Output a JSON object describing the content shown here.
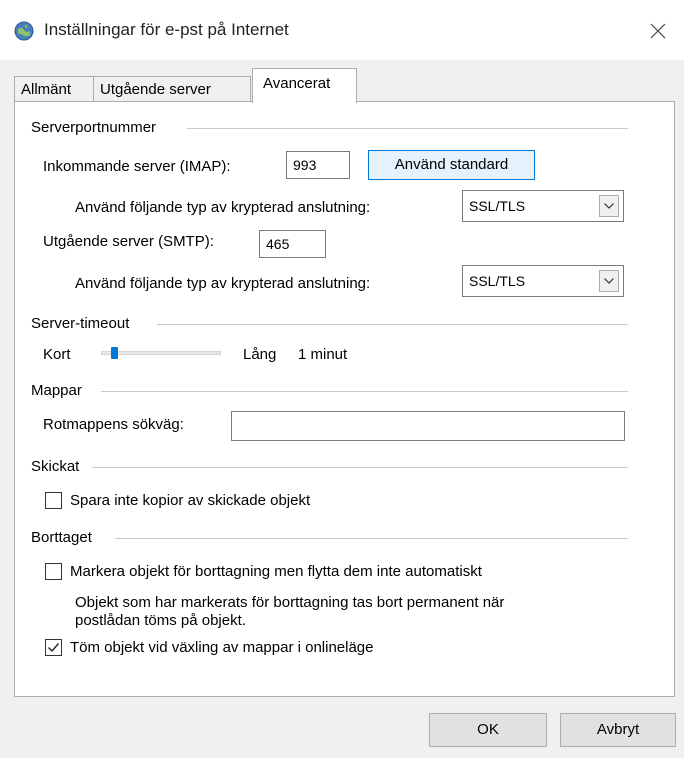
{
  "window": {
    "title": "Inställningar för e-pst på Internet"
  },
  "tabs": [
    {
      "label": "Allmänt"
    },
    {
      "label": "Utgående server"
    },
    {
      "label": "Avancerat"
    }
  ],
  "server_ports": {
    "group_label": "Serverportnummer",
    "incoming_label": "Inkommande server (IMAP):",
    "incoming_port": "993",
    "use_default_label": "Använd standard",
    "incoming_encryption_label": "Använd följande typ av krypterad anslutning:",
    "incoming_encryption_value": "SSL/TLS",
    "outgoing_label": "Utgående server (SMTP):",
    "outgoing_port": "465",
    "outgoing_encryption_label": "Använd följande typ av krypterad anslutning:",
    "outgoing_encryption_value": "SSL/TLS"
  },
  "server_timeout": {
    "group_label": "Server-timeout",
    "short_label": "Kort",
    "long_label": "Lång",
    "value_label": "1 minut",
    "slider_fraction": 0.1
  },
  "folders": {
    "group_label": "Mappar",
    "root_path_label": "Rotmappens sökväg:",
    "root_path_value": ""
  },
  "sent": {
    "group_label": "Skickat",
    "dont_save_label": "Spara inte kopior av skickade objekt",
    "dont_save_checked": false
  },
  "deleted": {
    "group_label": "Borttaget",
    "mark_label": "Markera objekt för borttagning men flytta dem inte automatiskt",
    "mark_checked": false,
    "info_line1": "Objekt som har markerats för borttagning tas bort permanent när",
    "info_line2": "postlådan töms på objekt.",
    "purge_label": "Töm objekt vid växling av mappar i onlineläge",
    "purge_checked": true
  },
  "footer": {
    "ok_label": "OK",
    "cancel_label": "Avbryt"
  },
  "colors": {
    "accent": "#0078d7",
    "window_bg": "#f0f0f0"
  }
}
